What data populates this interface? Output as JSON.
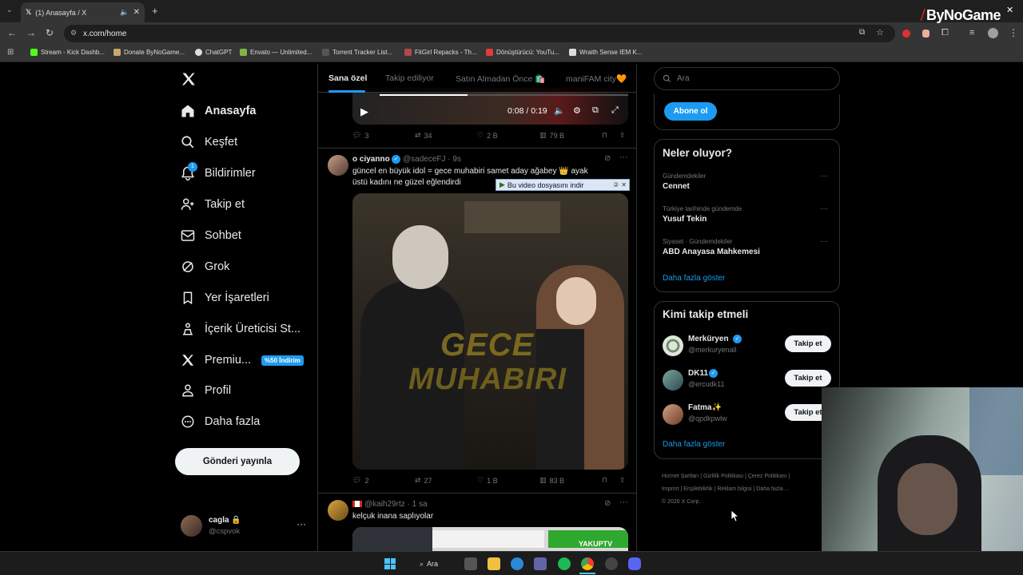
{
  "browser": {
    "tab_title": "(1) Anasayfa / X",
    "url": "x.com/home",
    "bookmarks": [
      {
        "label": "Stream - Kick Dashb...",
        "color": "#53fc18"
      },
      {
        "label": "Donate ByNoGame...",
        "color": "#c8a96b"
      },
      {
        "label": "ChatGPT",
        "color": "#dddddd"
      },
      {
        "label": "Envato — Unlimited...",
        "color": "#82b541"
      },
      {
        "label": "Torrent Tracker List...",
        "color": "#555555"
      },
      {
        "label": "FitGirl Repacks - Th...",
        "color": "#b04a4a"
      },
      {
        "label": "Dönüştürücü: YouTu...",
        "color": "#e33b3b"
      },
      {
        "label": "Wraith Sense IEM K...",
        "color": "#dddddd"
      }
    ]
  },
  "watermark": "ByNoGame",
  "nav": {
    "items": [
      "Anasayfa",
      "Keşfet",
      "Bildirimler",
      "Takip et",
      "Sohbet",
      "Grok",
      "Yer İşaretleri",
      "İçerik Üreticisi St...",
      "Premiu...",
      "Profil",
      "Daha fazla"
    ],
    "notification_badge": "1",
    "premium_badge": "%50 İndirim",
    "post_button": "Gönderi yayınla",
    "account_name": "cagla",
    "account_handle": "@cspvok"
  },
  "feed": {
    "tabs": [
      "Sana özel",
      "Takip ediliyor",
      "Satın Almadan Önce 🛍️",
      "maniFAM city🧡"
    ],
    "video_time": "0:08 / 0:19",
    "prev_tweet_stats": {
      "replies": "3",
      "reposts": "34",
      "likes": "2 B",
      "views": "79 B"
    },
    "tweet1": {
      "name": "o ciyanno",
      "handle": "@sadeceFJ · 9s",
      "text": "güncel en büyük idol = gece muhabiri samet aday ağabey 👑 ayak üstü kadını ne güzel eğlendirdi",
      "download_bar": "Bu video dosyasını indir",
      "overlay_line1": "GECE",
      "overlay_line2": "MUHABIRI",
      "stats": {
        "replies": "2",
        "reposts": "27",
        "likes": "1 B",
        "views": "83 B"
      }
    },
    "tweet2": {
      "handle": "@kaih29rtz · 1 sa",
      "text": "kelçuk inana saplıyolar",
      "media_label": "YAKUPTV"
    }
  },
  "right": {
    "search_placeholder": "Ara",
    "subscribe_button": "Abone ol",
    "trends_title": "Neler oluyor?",
    "trends": [
      {
        "meta": "Gündemdekiler",
        "name": "Cennet"
      },
      {
        "meta": "Türkiye tarihinde gündemde",
        "name": "Yusuf Tekin"
      },
      {
        "meta": "Siyaset · Gündemdekiler",
        "name": "ABD Anayasa Mahkemesi"
      }
    ],
    "trends_more": "Daha fazla göster",
    "who_title": "Kimi takip etmeli",
    "who": [
      {
        "name": "Merküryen",
        "handle": "@merkuryenall",
        "btn": "Takip et"
      },
      {
        "name": "DK11",
        "handle": "@ercudk11",
        "btn": "Takip et"
      },
      {
        "name": "Fatma✨",
        "handle": "@qpdkpwlw",
        "btn": "Takip et"
      }
    ],
    "who_more": "Daha fazla göster",
    "footer_line1": "Hizmet Şartları  |  Gizlilik Politikası  |  Çerez Politikası  |",
    "footer_line2": "Imprint  |  Erişilebilirlik  |  Reklam bilgisi  |  Daha fazla ...",
    "footer_copy": "© 2026 X Corp."
  },
  "taskbar": {
    "search_label": "Ara"
  }
}
